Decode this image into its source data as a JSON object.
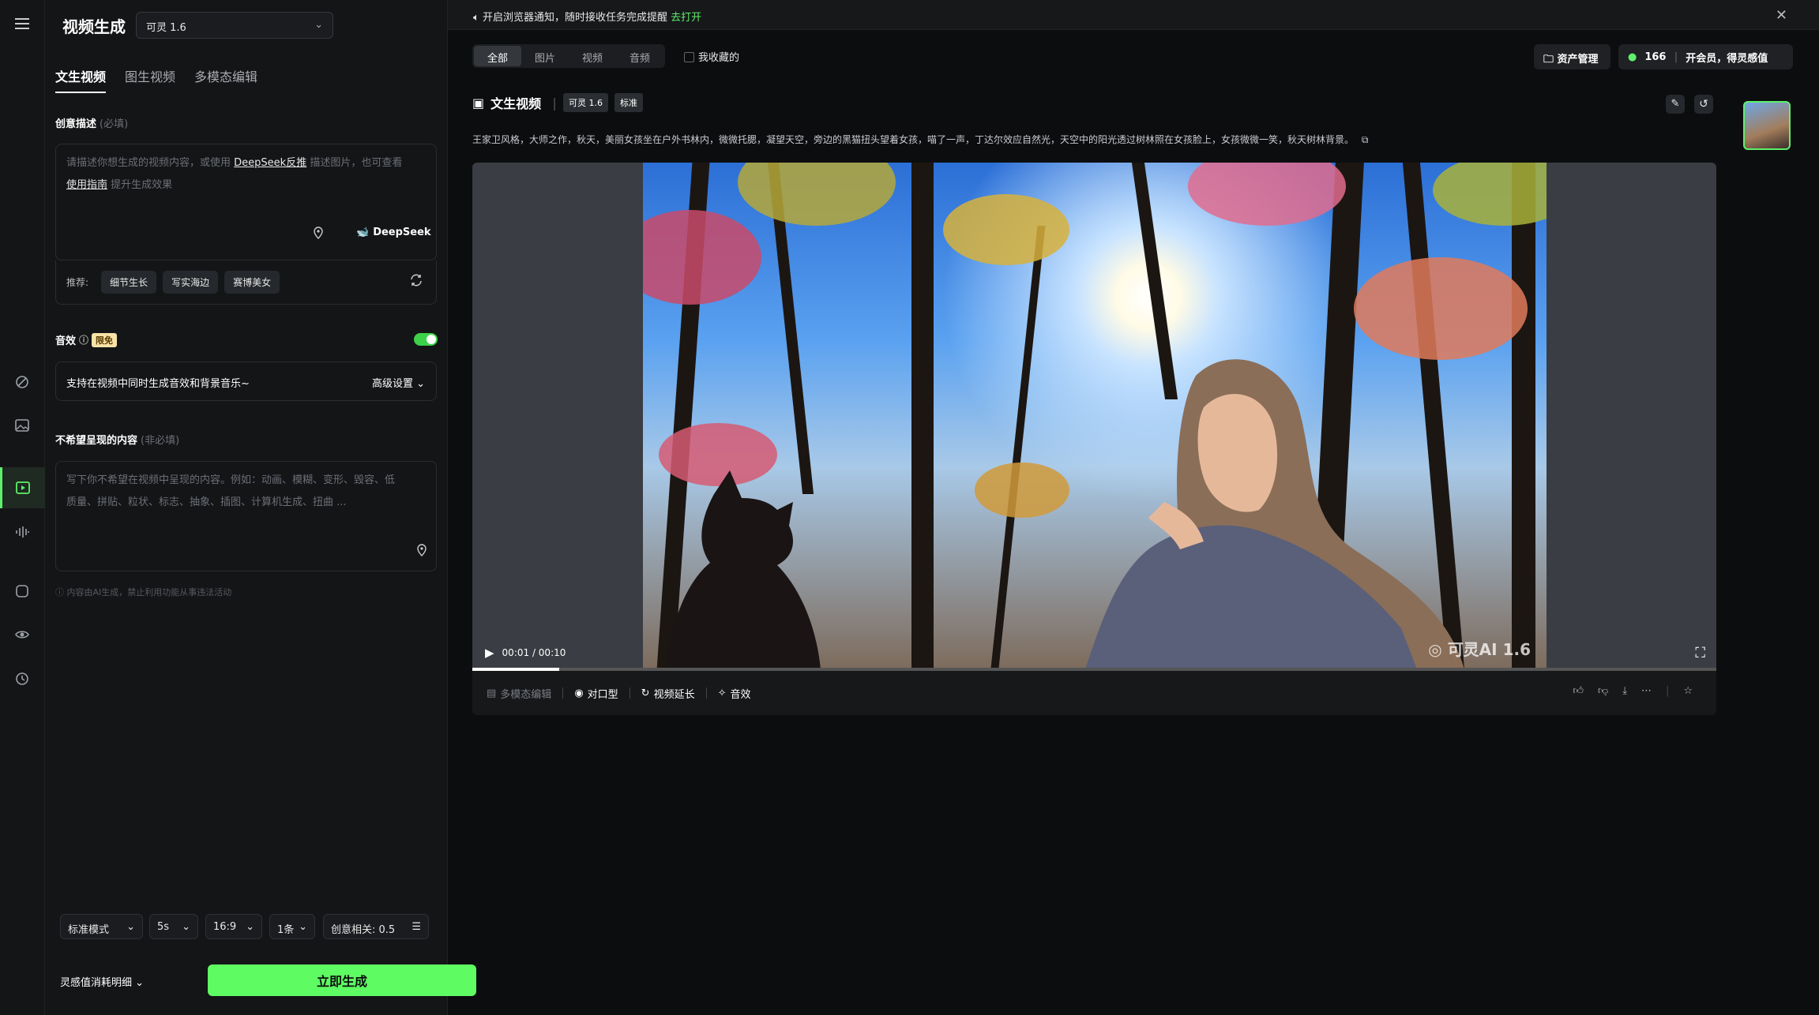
{
  "panel": {
    "title": "视频生成",
    "model": "可灵 1.6",
    "tabs": [
      "文生视频",
      "图生视频",
      "多模态编辑"
    ],
    "prompt_label": "创意描述",
    "prompt_required": "(必填)",
    "prompt_placeholder_1": "请描述你想生成的视频内容，或使用",
    "prompt_link_1": "DeepSeek反推",
    "prompt_placeholder_2": "描述图片，也可查看",
    "prompt_link_2": "使用指南",
    "prompt_placeholder_3": "提升生成效果",
    "deepseek": "DeepSeek",
    "recommend_label": "推荐:",
    "recommend_chips": [
      "细节生长",
      "写实海边",
      "赛博美女"
    ],
    "sound_label": "音效",
    "sound_badge": "限免",
    "sound_text": "支持在视频中同时生成音效和背景音乐~",
    "advanced": "高级设置",
    "negative_label": "不希望呈现的内容",
    "negative_hint": "(非必填)",
    "negative_placeholder_1": "写下你不希望在视频中呈现的内容。例如：动画、模糊、变形、毁容、低",
    "negative_placeholder_2": "质量、拼贴、粒状、标志、抽象、插图、计算机生成、扭曲 ...",
    "disclaimer": "内容由AI生成，禁止利用功能从事违法活动",
    "settings": {
      "mode": "标准模式",
      "duration": "5s",
      "ratio": "16:9",
      "count": "1条",
      "creativity": "创意相关: 0.5"
    },
    "cost": "灵感值消耗明细",
    "generate": "立即生成"
  },
  "notif": {
    "text": "开启浏览器通知，随时接收任务完成提醒",
    "action": "去打开"
  },
  "filters": [
    "全部",
    "图片",
    "视频",
    "音频"
  ],
  "fav": "我收藏的",
  "topbar": {
    "assets": "资产管理",
    "points": "166",
    "vip": "开会员，得灵感值"
  },
  "card": {
    "title": "文生视频",
    "model_tag": "可灵 1.6",
    "quality_tag": "标准",
    "description": "王家卫风格，大师之作，秋天，美丽女孩坐在户外书林内，微微托腮，凝望天空，旁边的黑猫扭头望着女孩，喵了一声，丁达尔效应自然光，天空中的阳光透过树林照在女孩脸上，女孩微微一笑，秋天树林背景。",
    "time": "00:01 / 00:10",
    "watermark": "可灵AI 1.6",
    "progress": 0.07,
    "actions": [
      "多模态编辑",
      "对口型",
      "视频延长",
      "音效"
    ]
  },
  "colors": {
    "accent": "#5ef06b",
    "generate": "#5efc62"
  }
}
